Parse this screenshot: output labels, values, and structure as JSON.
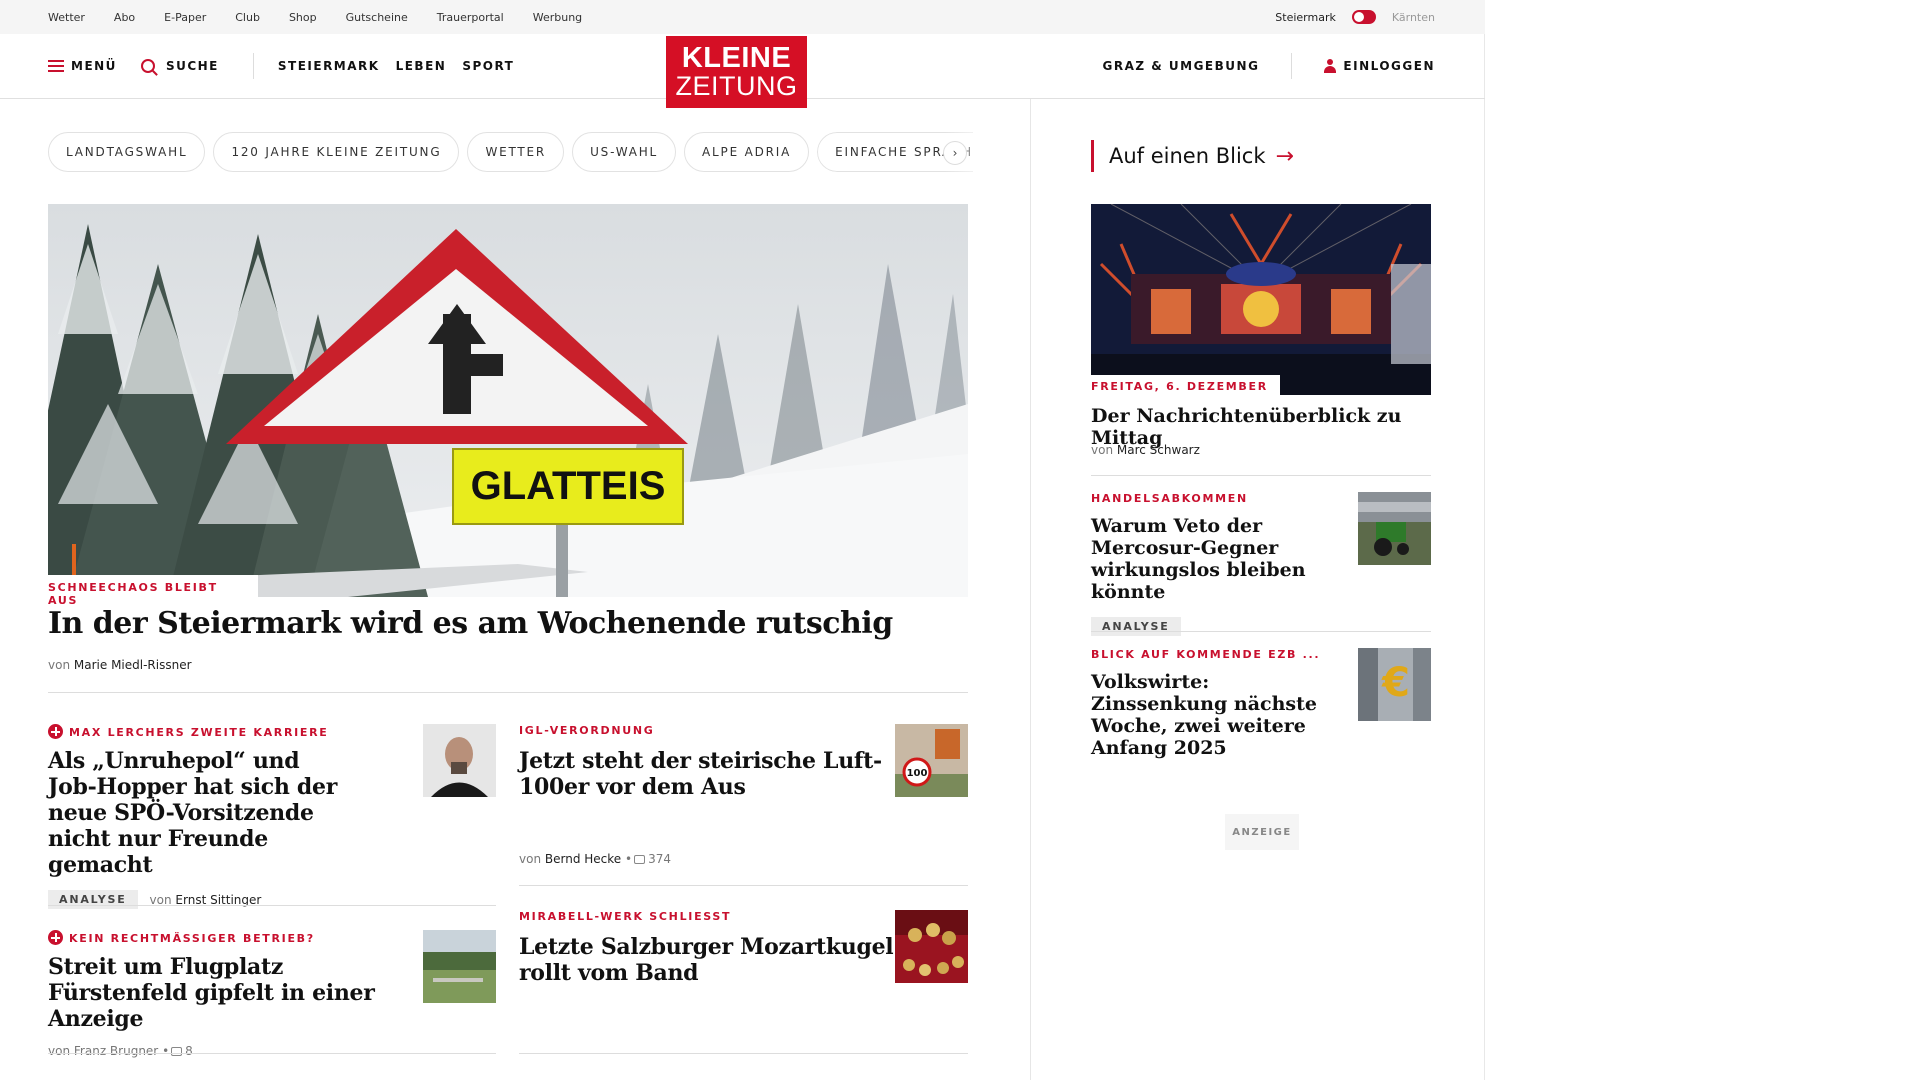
{
  "utility": {
    "links": [
      "Wetter",
      "Abo",
      "E-Paper",
      "Club",
      "Shop",
      "Gutscheine",
      "Trauerportal",
      "Werbung"
    ],
    "region_active": "Steiermark",
    "region_inactive": "Kärnten"
  },
  "header": {
    "menu_label": "MENÜ",
    "search_label": "SUCHE",
    "sections": [
      "STEIERMARK",
      "LEBEN",
      "SPORT"
    ],
    "local_label": "GRAZ & UMGEBUNG",
    "login_label": "EINLOGGEN",
    "logo_line1": "KLEINE",
    "logo_line2": "ZEITUNG"
  },
  "topics": [
    "LANDTAGSWAHL",
    "120 JAHRE KLEINE ZEITUNG",
    "WETTER",
    "US-WAHL",
    "ALPE ADRIA",
    "EINFACHE SPRACHE"
  ],
  "topics_next_glyph": "›",
  "hero": {
    "kicker": "SCHNEECHAOS BLEIBT AUS",
    "title": "In der Steiermark wird es am Wochenende rutschig",
    "by_prefix": "von",
    "author": "Marie Miedl-Rissner",
    "sign_text": "GLATTEIS"
  },
  "articles": {
    "a1": {
      "kicker": "MAX LERCHERS ZWEITE KARRIERE",
      "title": "Als „Unruhepol“ und Job-Hopper hat sich der neue SPÖ-Vorsitzende nicht nur Freunde gemacht",
      "tag": "ANALYSE",
      "by_prefix": "von",
      "author": "Ernst Sittinger"
    },
    "a2": {
      "kicker": "IGL-VERORDNUNG",
      "title": "Jetzt steht der steirische Luft-100er vor dem Aus",
      "by_prefix": "von",
      "author": "Bernd Hecke",
      "sep": "•",
      "comments": "374"
    },
    "a3": {
      "kicker": "KEIN RECHTMÄSSIGER BETRIEB?",
      "title": "Streit um Flugplatz Fürstenfeld gipfelt in einer Anzeige",
      "by_prefix": "von",
      "author": "Franz Brugner",
      "sep": "•",
      "comments": "8"
    },
    "a4": {
      "kicker": "MIRABELL-WERK SCHLIESST",
      "title": "Letzte Salzburger Mozartkugel rollt vom Band"
    }
  },
  "sidebar": {
    "heading": "Auf einen Blick",
    "heading_arrow": "→",
    "feature": {
      "kicker": "FREITAG, 6. DEZEMBER",
      "title": "Der Nachrichtenüberblick zu Mittag",
      "by_prefix": "von",
      "author": "Marc Schwarz"
    },
    "s1": {
      "kicker": "HANDELSABKOMMEN",
      "title": "Warum Veto der Mercosur-Gegner wirkungslos bleiben könnte",
      "tag": "ANALYSE"
    },
    "s2": {
      "kicker": "BLICK AUF KOMMENDE EZB ...",
      "title": "Volkswirte: Zinssenkung nächste Woche, zwei weitere Anfang 2025"
    },
    "ad_label": "ANZEIGE"
  },
  "colors": {
    "brand": "#d50f25",
    "accent": "#c8102e"
  }
}
